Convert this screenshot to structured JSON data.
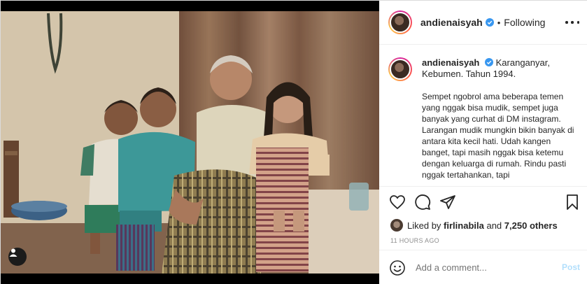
{
  "post": {
    "username": "andienaisyah",
    "follow_status": "Following",
    "separator": "•"
  },
  "caption": {
    "username": "andienaisyah",
    "location_line": "Karanganyar, Kebumen. Tahun 1994.",
    "body": "Sempet ngobrol ama beberapa temen yang nggak bisa mudik, sempet juga banyak yang curhat di DM instagram. Larangan mudik mungkin bikin banyak di antara kita kecil hati. Udah kangen banget, tapi masih nggak bisa ketemu dengan keluarga di rumah. Rindu pasti nggak tertahankan, tapi"
  },
  "likes": {
    "prefix": "Liked by",
    "liker": "firlinabila",
    "connector": "and",
    "others": "7,250 others"
  },
  "timestamp": "11 HOURS AGO",
  "comment_box": {
    "placeholder": "Add a comment...",
    "post_label": "Post"
  },
  "icons": {
    "verified": "verified-badge-icon",
    "more": "more-options-icon",
    "like": "heart-icon",
    "comment": "comment-bubble-icon",
    "share": "paper-plane-icon",
    "save": "bookmark-icon",
    "emoji": "smiley-icon",
    "user_tag": "user-tag-icon"
  },
  "colors": {
    "verified_blue": "#3897f0",
    "post_button_disabled": "#b2dffc",
    "muted_text": "#8e8e8e",
    "text": "#262626",
    "divider": "#efefef"
  }
}
